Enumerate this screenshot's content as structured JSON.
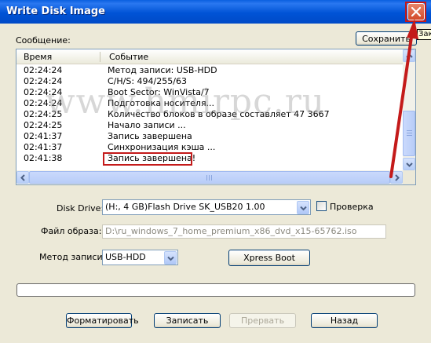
{
  "window": {
    "title": "Write Disk Image",
    "tooltip_fragment": "Зак"
  },
  "log": {
    "label": "Сообщение:",
    "save_label": "Сохранить",
    "col_time": "Время",
    "col_event": "Событие",
    "rows": [
      {
        "time": "02:24:24",
        "event": "Метод записи: USB-HDD"
      },
      {
        "time": "02:24:24",
        "event": "C/H/S: 494/255/63"
      },
      {
        "time": "02:24:24",
        "event": "Boot Sector: WinVista/7"
      },
      {
        "time": "02:24:24",
        "event": "Подготовка носителя..."
      },
      {
        "time": "02:24:25",
        "event": "Количество блоков в образе составляет 47 3667"
      },
      {
        "time": "02:24:25",
        "event": "Начало записи ..."
      },
      {
        "time": "02:41:37",
        "event": "Запись завершена"
      },
      {
        "time": "02:41:37",
        "event": "Синхронизация кэша ..."
      },
      {
        "time": "02:41:38",
        "event": "Запись завершена!"
      }
    ]
  },
  "form": {
    "disk_drive_label": "Disk Drive:",
    "disk_drive_value": "(H:, 4 GB)Flash   Drive SK_USB20  1.00",
    "verify_label": "Проверка",
    "image_file_label": "Файл образа:",
    "image_file_value": "D:\\ru_windows_7_home_premium_x86_dvd_x15-65762.iso",
    "write_method_label": "Метод записи:",
    "write_method_value": "USB-HDD",
    "xpress_boot_label": "Xpress Boot"
  },
  "progress": {
    "value": 0
  },
  "buttons": {
    "format": "Форматировать",
    "write": "Записать",
    "abort": "Прервать",
    "back": "Назад"
  },
  "watermark": "www.hmirpc.ru",
  "colors": {
    "title_bar": "#0053d6",
    "dialog_bg": "#ece9d8",
    "annotation_red": "#c41a1a",
    "close_button": "#d24a2a"
  }
}
